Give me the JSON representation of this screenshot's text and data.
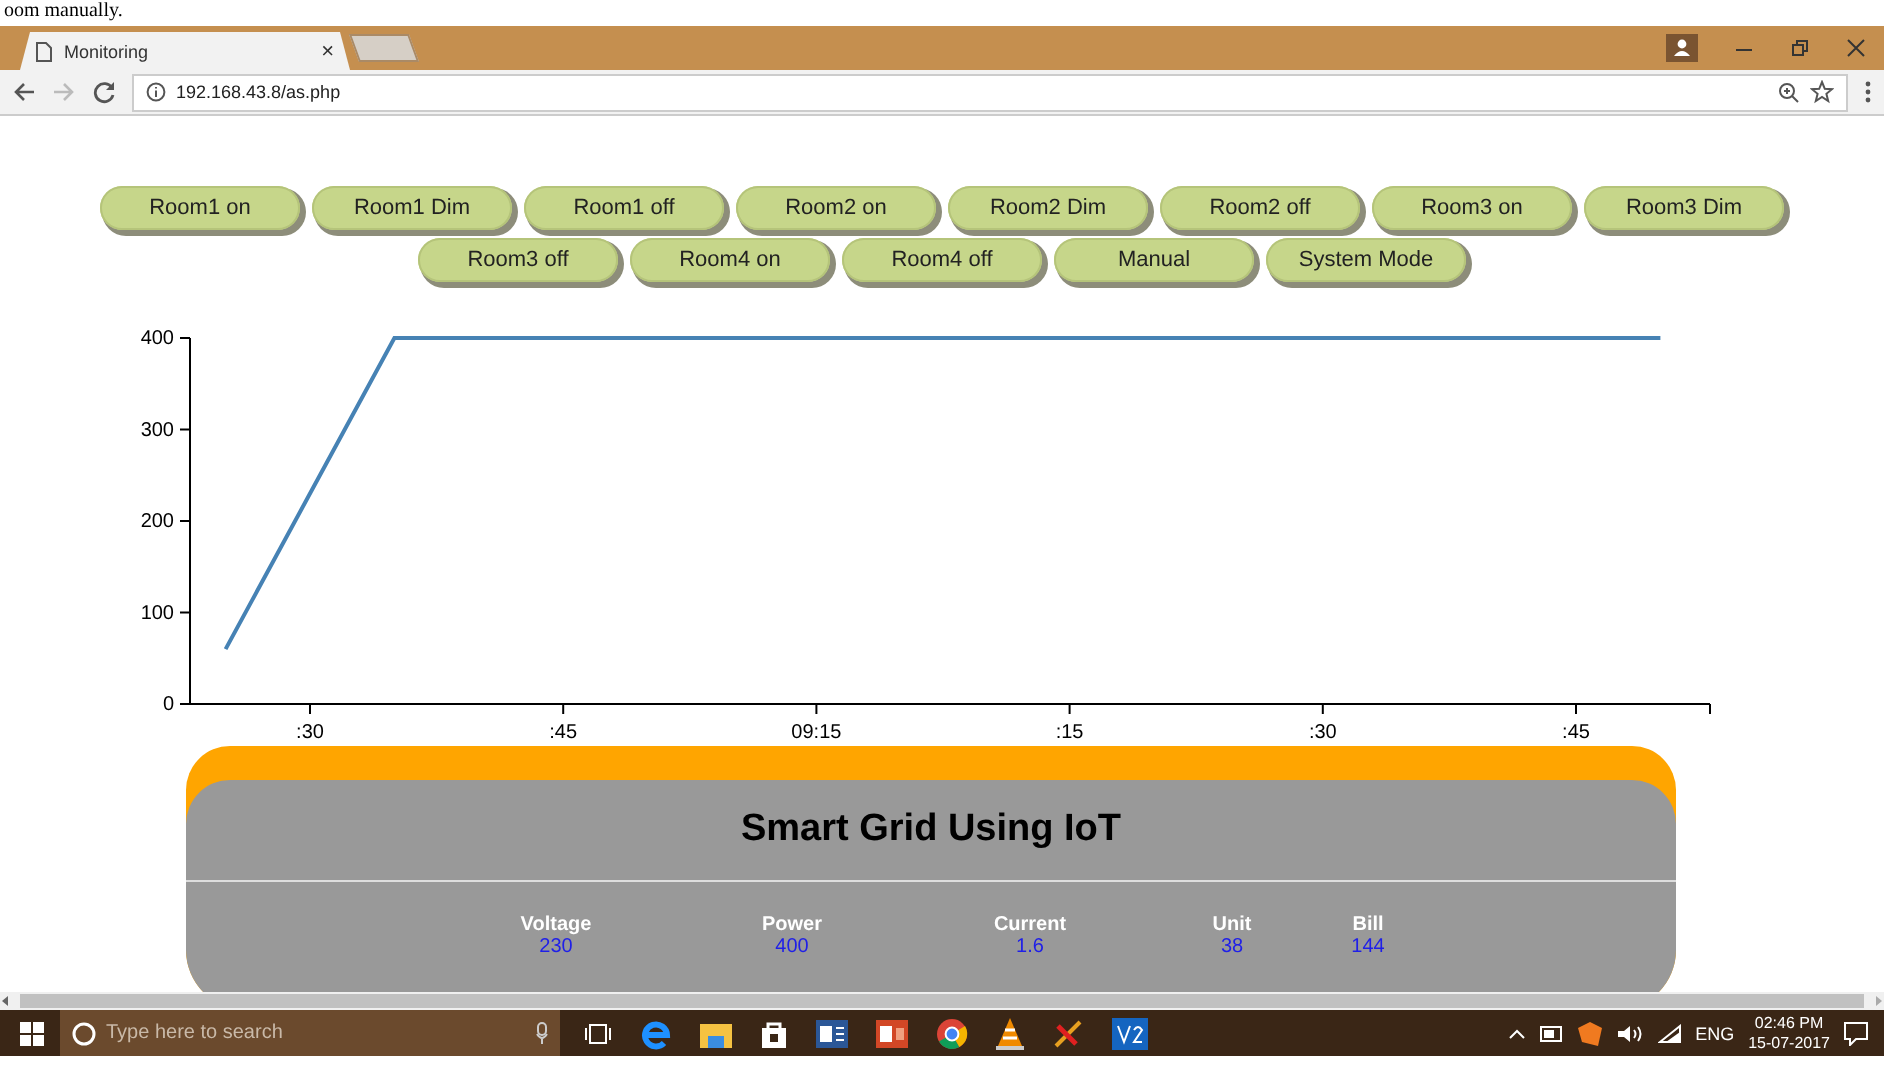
{
  "document_caption": "oom manually.",
  "browser": {
    "tab": {
      "title": "Monitoring",
      "close": "×",
      "selected": true
    },
    "url": "192.168.43.8/as.php"
  },
  "controls": [
    {
      "label": "Room1 on"
    },
    {
      "label": "Room1 Dim"
    },
    {
      "label": "Room1 off"
    },
    {
      "label": "Room2 on"
    },
    {
      "label": "Room2 Dim"
    },
    {
      "label": "Room2 off"
    },
    {
      "label": "Room3 on"
    },
    {
      "label": "Room3 Dim"
    },
    {
      "label": "Room3 off"
    },
    {
      "label": "Room4 on"
    },
    {
      "label": "Room4 off"
    },
    {
      "label": "Manual"
    },
    {
      "label": "System Mode"
    }
  ],
  "chart_data": {
    "type": "line",
    "ylim": [
      0,
      400
    ],
    "categories": [
      null,
      ":30",
      null,
      null,
      ":45",
      null,
      null,
      "09:15",
      null,
      null,
      ":15",
      null,
      null,
      ":30",
      null,
      null,
      ":45",
      null
    ],
    "yticks": [
      0,
      100,
      200,
      300,
      400
    ],
    "series": [
      {
        "color": "#4682b4",
        "values": [
          60,
          230,
          400,
          400,
          400,
          400,
          400,
          400,
          400,
          400,
          400,
          400,
          400,
          400,
          400,
          400,
          400,
          400
        ]
      }
    ]
  },
  "panel": {
    "title": "Smart Grid Using IoT",
    "metrics": [
      {
        "label": "Voltage",
        "value": "230"
      },
      {
        "label": "Power",
        "value": "400"
      },
      {
        "label": "Current",
        "value": "1.6"
      },
      {
        "label": "Unit",
        "value": "38"
      },
      {
        "label": "Bill",
        "value": "144"
      }
    ]
  },
  "taskbar": {
    "search_placeholder": "Type here to search",
    "language": "ENG",
    "time": "02:46 PM",
    "date": "15-07-2017"
  }
}
